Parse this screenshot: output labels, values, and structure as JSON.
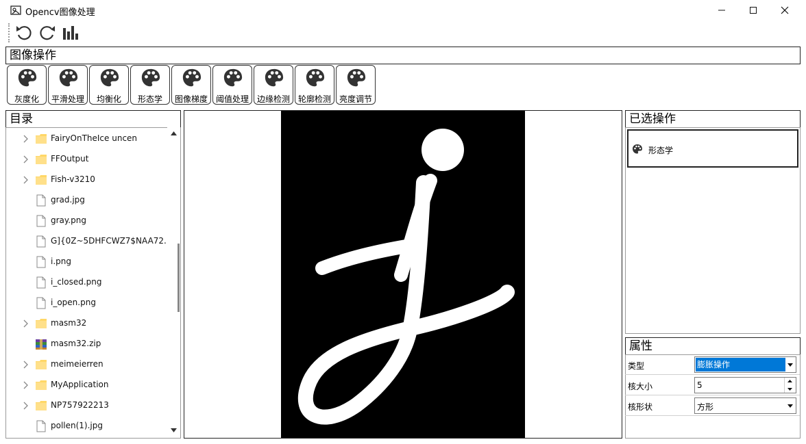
{
  "window": {
    "title": "Opencv图像处理",
    "controls": [
      "minimize",
      "maximize",
      "close"
    ]
  },
  "toolbar": {
    "buttons": [
      {
        "name": "undo",
        "icon": "undo-icon"
      },
      {
        "name": "redo",
        "icon": "redo-icon"
      },
      {
        "name": "histogram",
        "icon": "bar-chart-icon"
      }
    ]
  },
  "operations": {
    "header": "图像操作",
    "buttons": [
      {
        "label": "灰度化",
        "icon": "palette-icon"
      },
      {
        "label": "平滑处理",
        "icon": "palette-icon"
      },
      {
        "label": "均衡化",
        "icon": "palette-icon"
      },
      {
        "label": "形态学",
        "icon": "palette-icon"
      },
      {
        "label": "图像梯度",
        "icon": "palette-icon"
      },
      {
        "label": "阈值处理",
        "icon": "palette-icon"
      },
      {
        "label": "边缘检测",
        "icon": "palette-icon"
      },
      {
        "label": "轮廓检测",
        "icon": "palette-icon"
      },
      {
        "label": "亮度调节",
        "icon": "palette-icon"
      }
    ]
  },
  "directory": {
    "header": "目录",
    "items": [
      {
        "name": "FairyOnTheIce uncen",
        "type": "folder"
      },
      {
        "name": "FFOutput",
        "type": "folder"
      },
      {
        "name": "Fish-v3210",
        "type": "folder"
      },
      {
        "name": "grad.jpg",
        "type": "file"
      },
      {
        "name": "gray.png",
        "type": "file"
      },
      {
        "name": "G]{0Z~5DHFCWZ7$NAA72...",
        "type": "file"
      },
      {
        "name": "i.png",
        "type": "file"
      },
      {
        "name": "i_closed.png",
        "type": "file"
      },
      {
        "name": "i_open.png",
        "type": "file"
      },
      {
        "name": "masm32",
        "type": "folder"
      },
      {
        "name": "masm32.zip",
        "type": "archive"
      },
      {
        "name": "meimeierren",
        "type": "folder"
      },
      {
        "name": "MyApplication",
        "type": "folder"
      },
      {
        "name": "NP757922213",
        "type": "folder"
      },
      {
        "name": "pollen(1).jpg",
        "type": "file"
      }
    ]
  },
  "selected_ops": {
    "header": "已选操作",
    "items": [
      {
        "label": "形态学",
        "icon": "palette-icon"
      }
    ]
  },
  "properties": {
    "header": "属性",
    "rows": [
      {
        "label": "类型",
        "value": "膨胀操作",
        "control": "dropdown"
      },
      {
        "label": "核大小",
        "value": "5",
        "control": "spinbox"
      },
      {
        "label": "核形状",
        "value": "方形",
        "control": "dropdown"
      }
    ]
  },
  "colors": {
    "selection": "#0078d7",
    "border": "#222222"
  }
}
